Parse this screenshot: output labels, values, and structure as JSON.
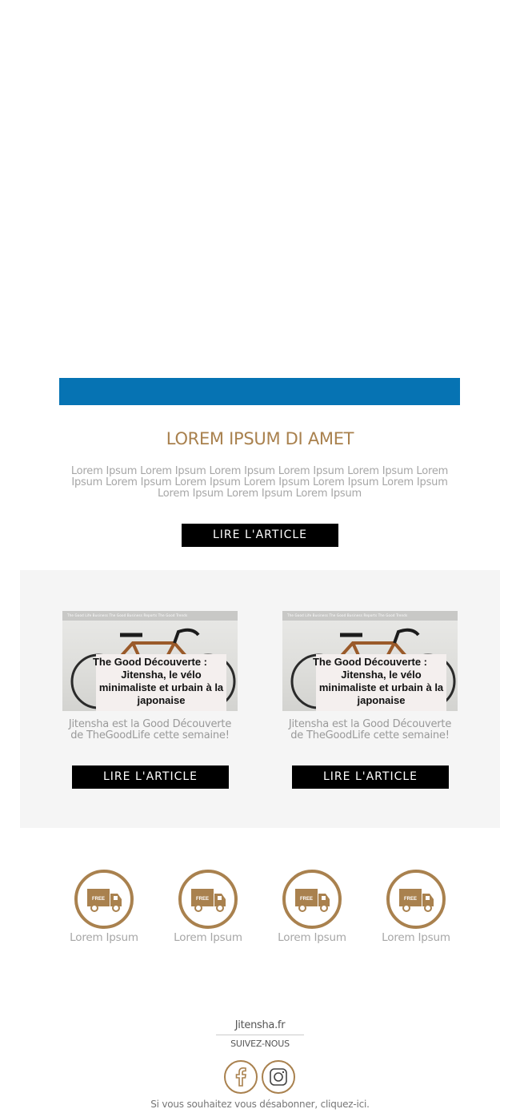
{
  "hero": {
    "title": "LOREM IPSUM DI AMET",
    "body": "Lorem Ipsum Lorem Ipsum Lorem Ipsum Lorem Ipsum Lorem Ipsum Lorem Ipsum Lorem Ipsum Lorem Ipsum Lorem Ipsum Lorem Ipsum Lorem Ipsum Lorem Ipsum Lorem Ipsum Lorem Ipsum",
    "button_label": "LIRE L'ARTICLE"
  },
  "cards": [
    {
      "image_nav": "The Good Life   Business   The Good Business   Reports   The Good Trends",
      "image_caption_1": "The Good Découverte :",
      "image_caption_2": "Jitensha, le vélo minimaliste et urbain à la japonaise",
      "text": "Jitensha est la Good Découverte de TheGoodLife cette semaine!",
      "button_label": "LIRE L'ARTICLE"
    },
    {
      "image_nav": "The Good Life   Business   The Good Business   Reports   The Good Trends",
      "image_caption_1": "The Good Découverte :",
      "image_caption_2": "Jitensha, le vélo minimaliste et urbain à la japonaise",
      "text": "Jitensha est la Good Découverte de TheGoodLife cette semaine!",
      "button_label": "LIRE L'ARTICLE"
    }
  ],
  "features": [
    {
      "icon": "free-delivery-truck-icon",
      "badge": "FREE",
      "label": "Lorem Ipsum"
    },
    {
      "icon": "free-delivery-truck-icon",
      "badge": "FREE",
      "label": "Lorem Ipsum"
    },
    {
      "icon": "free-delivery-truck-icon",
      "badge": "FREE",
      "label": "Lorem Ipsum"
    },
    {
      "icon": "free-delivery-truck-icon",
      "badge": "FREE",
      "label": "Lorem Ipsum"
    }
  ],
  "footer": {
    "brand": "Jitensha.fr",
    "follow": "SUIVEZ-NOUS",
    "social": [
      "facebook-icon",
      "instagram-icon"
    ],
    "unsubscribe_text": "Si vous souhaitez vous désabonner, ",
    "unsubscribe_link": "cliquez-ici."
  },
  "colors": {
    "accent_blue": "#0673b3",
    "gold": "#a9814e",
    "button": "#000000",
    "panel": "#f5f5f5"
  }
}
